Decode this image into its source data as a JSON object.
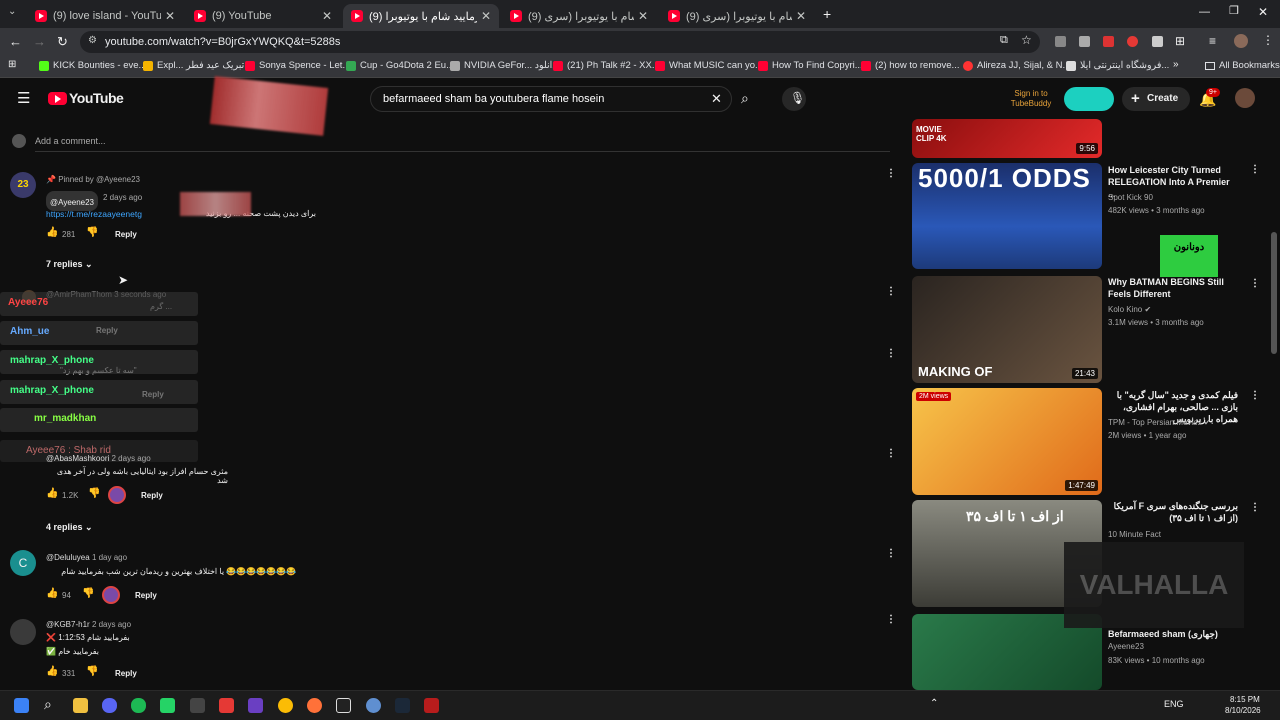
{
  "browser": {
    "tabs": [
      {
        "title": "(9) love island - YouTube",
        "active": false
      },
      {
        "title": "(9) YouTube",
        "active": false
      },
      {
        "title": "(9) بفرمایید شام با یوتیوبرا (...",
        "active": true
      },
      {
        "title": "(9) بفرمایید شام با یوتیوبرا (سری ...",
        "active": false
      },
      {
        "title": "(9) بفرمایید شام با یوتیوبرا (سری ...",
        "active": false
      }
    ],
    "url": "youtube.com/watch?v=B0jrGxYWQKQ&t=5288s",
    "bookmarks": [
      {
        "label": "KICK Bounties - eve...",
        "color": "#53fc18"
      },
      {
        "label": "Expl... تبریک عید فطر",
        "color": "#f4b400"
      },
      {
        "label": "Sonya Spence - Let...",
        "color": "#ff0033"
      },
      {
        "label": "Cup - Go4Dota 2 Eu...",
        "color": "#34a853"
      },
      {
        "label": "NVIDIA GeFor... دانلود",
        "color": "#aaaaaa"
      },
      {
        "label": "(21) Ph Talk #2 - XX...",
        "color": "#ff0033"
      },
      {
        "label": "What MUSIC can yo...",
        "color": "#ff0033"
      },
      {
        "label": "How To Find Copyri...",
        "color": "#ff0033"
      },
      {
        "label": "(2) how to remove...",
        "color": "#ff0033"
      },
      {
        "label": "Alireza JJ, Sijal, & N...",
        "color": "#ff3333"
      },
      {
        "label": "فروشگاه اینترنتی ایلا...",
        "color": "#dddddd"
      }
    ],
    "all_bookmarks": "All Bookmarks"
  },
  "youtube": {
    "logo_text": "YouTube",
    "search_value": "befarmaeed sham ba youtubera flame hosein",
    "sign_in": "Sign in to TubeBuddy",
    "create_label": "Create",
    "notif_badge": "9+"
  },
  "comments": {
    "add_placeholder": "Add a comment...",
    "pinned": {
      "pinned_by": "Pinned by @Ayeene23",
      "author": "@Ayeene23",
      "date": "2 days ago",
      "link": "https://t.me/rezaayeenetg",
      "text": "برای دیدن پشت صحنه ... رو بزنید",
      "likes": "281",
      "reply": "Reply",
      "replies_toggle": "7 replies"
    },
    "reply1": {
      "author": "@AmirPhamThom",
      "date": "3 seconds ago",
      "text": "گرم ...",
      "reply": "Reply"
    },
    "reply2": {
      "text": "\"سه تا عکسم و بهم زد\"",
      "reply": "Reply"
    },
    "second_thread": {
      "author": "@AbasMashkoori",
      "date": "2 days ago",
      "text": "مثری حسام افراز بود ایتالیایی باشه ولی در آخر هدی شد",
      "likes": "1.2K",
      "reply": "Reply",
      "replies_toggle": "4 replies"
    },
    "third": {
      "author": "@Deluluyea",
      "date": "1 day ago",
      "text": "😂😂😂😂😂😂😂 یا اختلاف بهترین و ریدمان ترین شب بفرمایید شام",
      "likes": "94",
      "reply": "Reply",
      "avatar_letter": "C"
    },
    "fourth": {
      "author": "@KGB7-h1r",
      "date": "2 days ago",
      "line1": "❌ بفرمایید شام 1:12:53",
      "line2": "✅ بفرمایید خام",
      "likes": "331",
      "reply": "Reply"
    }
  },
  "chat_overlay": [
    {
      "name": "Ayeee76",
      "color": "#ff4444"
    },
    {
      "name": "Ahm_ue",
      "color": "#66aaff"
    },
    {
      "name": "mahrap_X_phone",
      "color": "#44ff88"
    },
    {
      "name": "mahrap_X_phone",
      "color": "#44ff88"
    },
    {
      "name": "mr_madkhan",
      "color": "#88ff44"
    },
    {
      "name": "Ayeee76 : Shab rid",
      "color": "#ff6666"
    }
  ],
  "sidebar_videos": [
    {
      "badge": "MOVIE CLIP 4K",
      "duration": "9:56",
      "title": "",
      "channel": "",
      "meta": "",
      "bg": "#c41a1a"
    },
    {
      "badge": "5000/1 ODDS",
      "duration": "",
      "title": "How Leicester City Turned RELEGATION Into A Premier ...",
      "channel": "Spot Kick 90",
      "meta": "482K views • 3 months ago",
      "bg": "#1d3f8f"
    },
    {
      "badge": "MAKING OF",
      "duration": "21:43",
      "title": "Why BATMAN BEGINS Still Feels Different",
      "channel": "Kolo Kino",
      "meta": "3.1M views • 3 months ago",
      "bg": "#4a3a30"
    },
    {
      "badge": "2M views",
      "duration": "1:47:49",
      "title": "فیلم کمدی و جدید \"سال گربه\" با بازی ... صالحی، بهرام افشاری، همراه با زیرنویس",
      "channel": "TPM - Top Persian Movies",
      "meta": "2M views • 1 year ago",
      "bg": "#e8801a"
    },
    {
      "badge": "از اف ۱ تا اف ۳۵",
      "duration": "",
      "title": "بررسی جنگنده‌های سری F آمریکا (از اف ۱ تا اف ۳۵)",
      "channel": "10 Minute Fact",
      "meta": "",
      "bg": "#5a5a52"
    },
    {
      "badge": "",
      "duration": "",
      "title": "Befarmaeed sham (جهاری)",
      "channel": "Ayeene23",
      "meta": "83K views • 10 months ago",
      "bg": "#1f6a3a"
    }
  ],
  "overlay_donate": "دونانون",
  "overlay_brand": "VALHALLA",
  "taskbar": {
    "lang": "ENG",
    "time": "8:15 PM",
    "date": "8/10/2026"
  }
}
